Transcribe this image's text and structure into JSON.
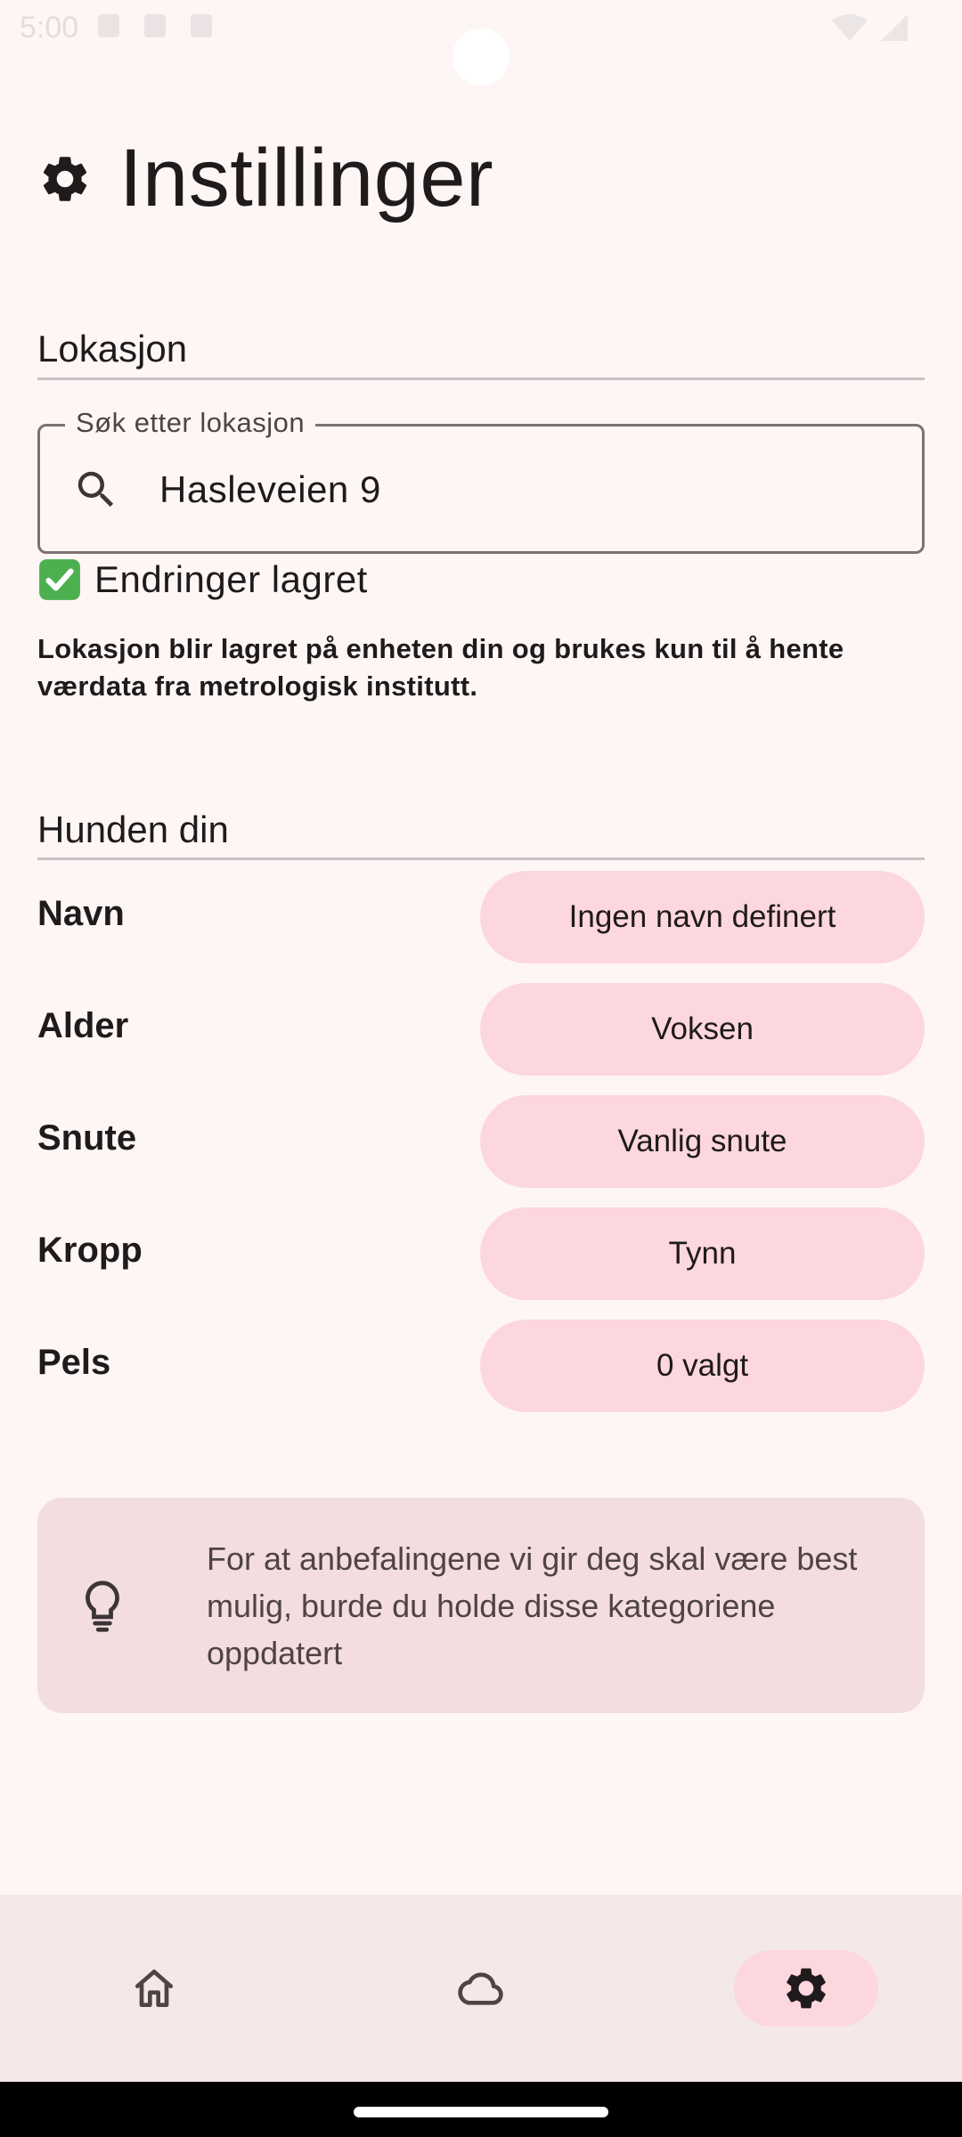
{
  "status_bar": {
    "time": "5:00"
  },
  "header": {
    "title": "Instillinger",
    "icon": "gear-icon"
  },
  "location_section": {
    "title": "Lokasjon",
    "search": {
      "label": "Søk etter lokasjon",
      "value": "Hasleveien 9",
      "icon": "search-icon"
    },
    "saved_status": "Endringer lagret",
    "info": "Lokasjon blir lagret på enheten din og brukes kun til å hente værdata fra metrologisk institutt."
  },
  "dog_section": {
    "title": "Hunden din",
    "rows": [
      {
        "label": "Navn",
        "value": "Ingen navn definert"
      },
      {
        "label": "Alder",
        "value": "Voksen"
      },
      {
        "label": "Snute",
        "value": "Vanlig snute"
      },
      {
        "label": "Kropp",
        "value": "Tynn"
      },
      {
        "label": "Pels",
        "value": "0 valgt"
      }
    ]
  },
  "tip": {
    "icon": "lightbulb-icon",
    "text": "For at anbefalingene vi gir deg skal være best mulig, burde du holde disse kategoriene oppdatert"
  },
  "bottom_nav": {
    "items": [
      {
        "icon": "home-icon",
        "active": false
      },
      {
        "icon": "cloud-icon",
        "active": false
      },
      {
        "icon": "gear-icon",
        "active": true
      }
    ]
  },
  "colors": {
    "background": "#fef6f5",
    "chip": "#fdd7de",
    "tip_card": "#f3dde0",
    "nav_bar": "#f4e8e8",
    "text": "#1f1a1b"
  }
}
